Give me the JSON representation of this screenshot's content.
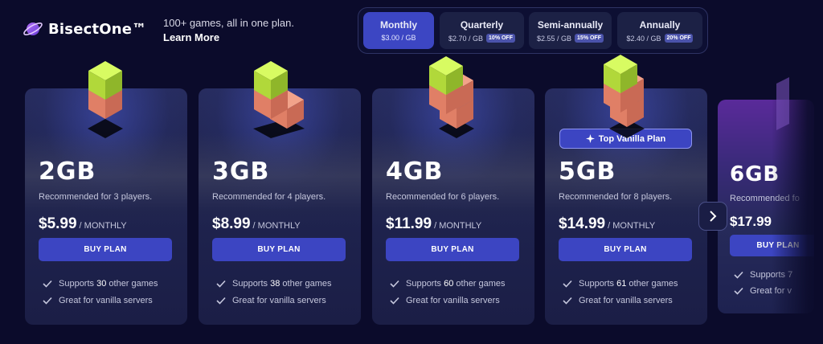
{
  "brand": {
    "name": "BisectOne™"
  },
  "tagline": {
    "text": "100+ games, all in one plan.",
    "link": "Learn More"
  },
  "billing": [
    {
      "name": "Monthly",
      "price": "$3.00 / GB",
      "badge": "",
      "active": true
    },
    {
      "name": "Quarterly",
      "price": "$2.70 / GB",
      "badge": "10% OFF",
      "active": false
    },
    {
      "name": "Semi-annually",
      "price": "$2.55 / GB",
      "badge": "15% OFF",
      "active": false
    },
    {
      "name": "Annually",
      "price": "$2.40 / GB",
      "badge": "20% OFF",
      "active": false
    }
  ],
  "plans": [
    {
      "size": "2GB",
      "recommended": "Recommended for 3 players.",
      "price": "$5.99",
      "period": "/ MONTHLY",
      "button": "BUY PLAN",
      "features": [
        {
          "pre": "Supports ",
          "hl": "30",
          "post": " other games"
        },
        {
          "pre": "Great for vanilla servers",
          "hl": "",
          "post": ""
        }
      ]
    },
    {
      "size": "3GB",
      "recommended": "Recommended for 4 players.",
      "price": "$8.99",
      "period": "/ MONTHLY",
      "button": "BUY PLAN",
      "features": [
        {
          "pre": "Supports ",
          "hl": "38",
          "post": " other games"
        },
        {
          "pre": "Great for vanilla servers",
          "hl": "",
          "post": ""
        }
      ]
    },
    {
      "size": "4GB",
      "recommended": "Recommended for 6 players.",
      "price": "$11.99",
      "period": "/ MONTHLY",
      "button": "BUY PLAN",
      "features": [
        {
          "pre": "Supports ",
          "hl": "60",
          "post": " other games"
        },
        {
          "pre": "Great for vanilla servers",
          "hl": "",
          "post": ""
        }
      ]
    },
    {
      "size": "5GB",
      "recommended": "Recommended for 8 players.",
      "price": "$14.99",
      "period": "/ MONTHLY",
      "button": "BUY PLAN",
      "badge": "Top Vanilla Plan",
      "features": [
        {
          "pre": "Supports ",
          "hl": "61",
          "post": " other games"
        },
        {
          "pre": "Great for vanilla servers",
          "hl": "",
          "post": ""
        }
      ]
    },
    {
      "size": "6GB",
      "recommended": "Recommended fo",
      "price": "$17.99",
      "period": "",
      "button": "BUY PLAN",
      "features": [
        {
          "pre": "Supports 7",
          "hl": "",
          "post": ""
        },
        {
          "pre": "Great for v",
          "hl": "",
          "post": ""
        }
      ]
    }
  ],
  "colors": {
    "accent": "#3c45c2",
    "background": "#0b0b2b",
    "card": "#1f2450",
    "cube_top": "#c6f046",
    "cube_block": "#e4836b"
  },
  "icons": {
    "logo": "planet-logo-icon",
    "check": "check-icon",
    "next": "chevron-right-icon",
    "badge": "sparkle-icon"
  }
}
